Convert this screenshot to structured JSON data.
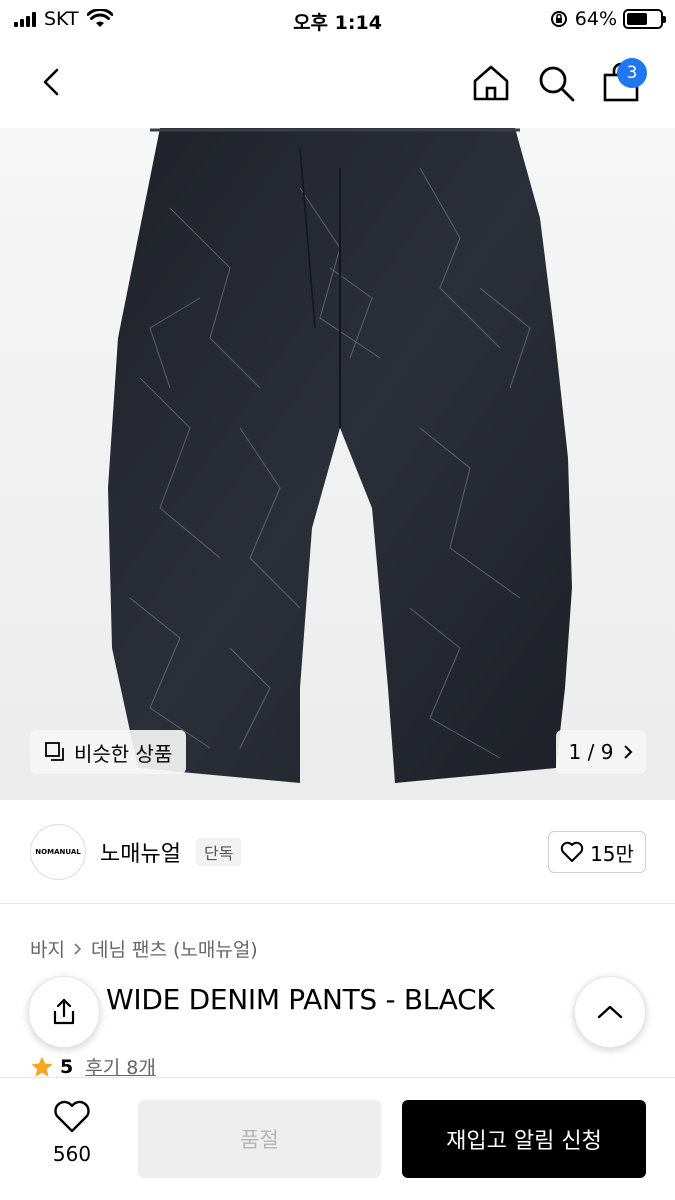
{
  "status_bar": {
    "carrier": "SKT",
    "time": "오후 1:14",
    "battery": "64%",
    "battery_level": 0.64
  },
  "nav": {
    "cart_count": "3",
    "icons": [
      "back-icon",
      "home-icon",
      "search-icon",
      "shopping-bag-icon"
    ]
  },
  "gallery": {
    "similar_label": "비슷한 상품",
    "page_current": "1",
    "page_separator": "/",
    "page_total": "9"
  },
  "brand": {
    "logo_text": "NOMANUAL",
    "name": "노매뉴얼",
    "tag": "단독",
    "likes": "15만"
  },
  "product": {
    "breadcrumb": [
      "바지",
      "데님 팬츠 (노매뉴얼)"
    ],
    "title": "WIDE DENIM PANTS - BLACK",
    "rating": "5",
    "reviews": "후기 8개"
  },
  "bottom_bar": {
    "wish_count": "560",
    "soldout_label": "품절",
    "notify_label": "재입고 알림 신청"
  },
  "colors": {
    "badge": "#1f78f0",
    "star": "#f5a623",
    "primary": "#000000",
    "disabled_bg": "#eeeeee",
    "disabled_text": "#b5b5b5"
  }
}
